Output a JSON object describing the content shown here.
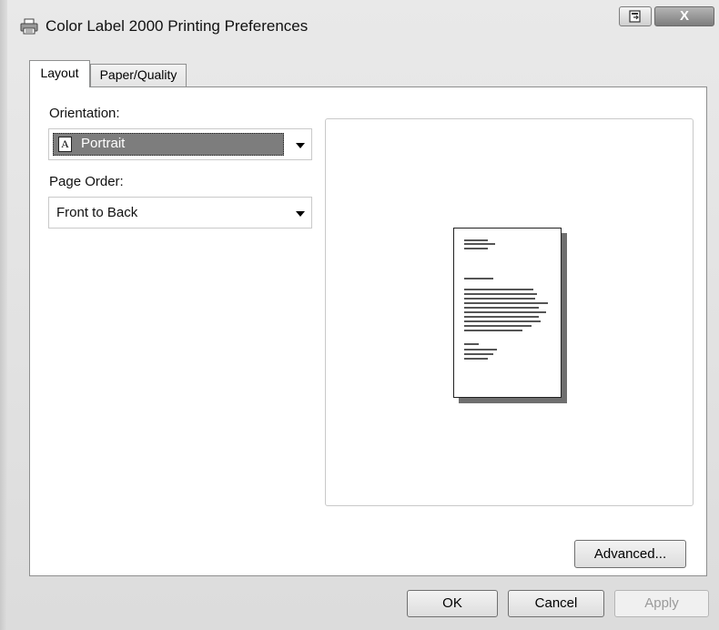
{
  "window": {
    "title": "Color Label 2000 Printing Preferences",
    "close_glyph": "X",
    "icons": {
      "app": "printer-icon",
      "restore": "restore-icon",
      "close": "close-icon"
    }
  },
  "tabs": [
    {
      "label": "Layout",
      "selected": true
    },
    {
      "label": "Paper/Quality",
      "selected": false
    }
  ],
  "orientation": {
    "label": "Orientation:",
    "value": "Portrait",
    "icon": "portrait-page-icon",
    "icon_letter": "A"
  },
  "page_order": {
    "label": "Page Order:",
    "value": "Front to Back"
  },
  "preview": {
    "icon": "page-preview-icon"
  },
  "buttons": {
    "advanced": "Advanced...",
    "ok": "OK",
    "cancel": "Cancel",
    "apply": "Apply"
  },
  "colors": {
    "selection": "#7d7d7d",
    "window_bg": "#e1e1e1",
    "close_button": "#8a8a8a"
  }
}
